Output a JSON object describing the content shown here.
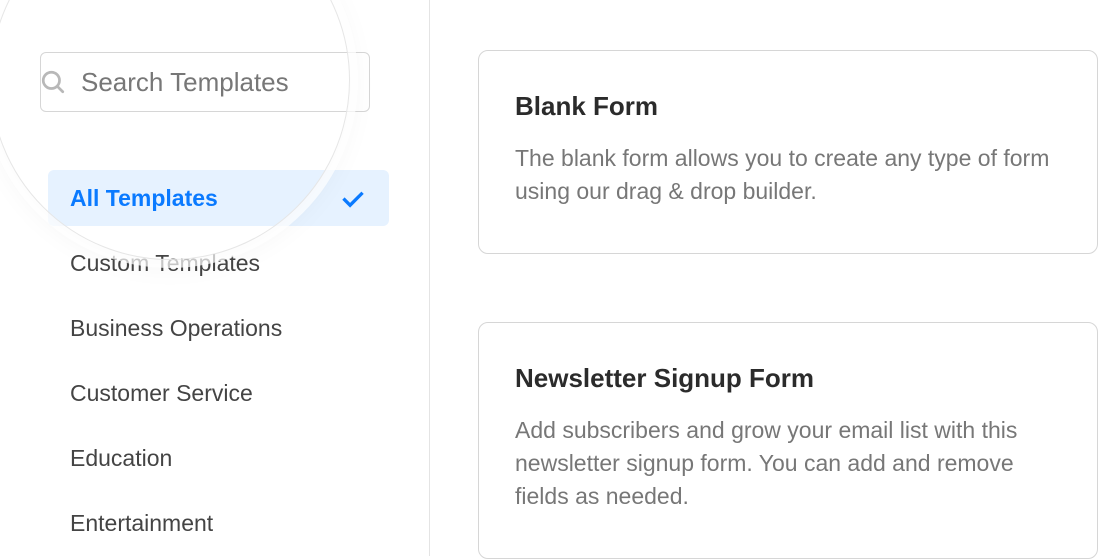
{
  "search": {
    "placeholder": "Search Templates",
    "value": ""
  },
  "categories": [
    {
      "label": "All Templates",
      "selected": true
    },
    {
      "label": "Custom Templates",
      "selected": false
    },
    {
      "label": "Business Operations",
      "selected": false
    },
    {
      "label": "Customer Service",
      "selected": false
    },
    {
      "label": "Education",
      "selected": false
    },
    {
      "label": "Entertainment",
      "selected": false
    }
  ],
  "templates": [
    {
      "title": "Blank Form",
      "desc": "The blank form allows you to create any type of form using our drag & drop builder."
    },
    {
      "title": "Newsletter Signup Form",
      "desc": "Add subscribers and grow your email list with this newsletter signup form. You can add and remove fields as needed."
    }
  ]
}
